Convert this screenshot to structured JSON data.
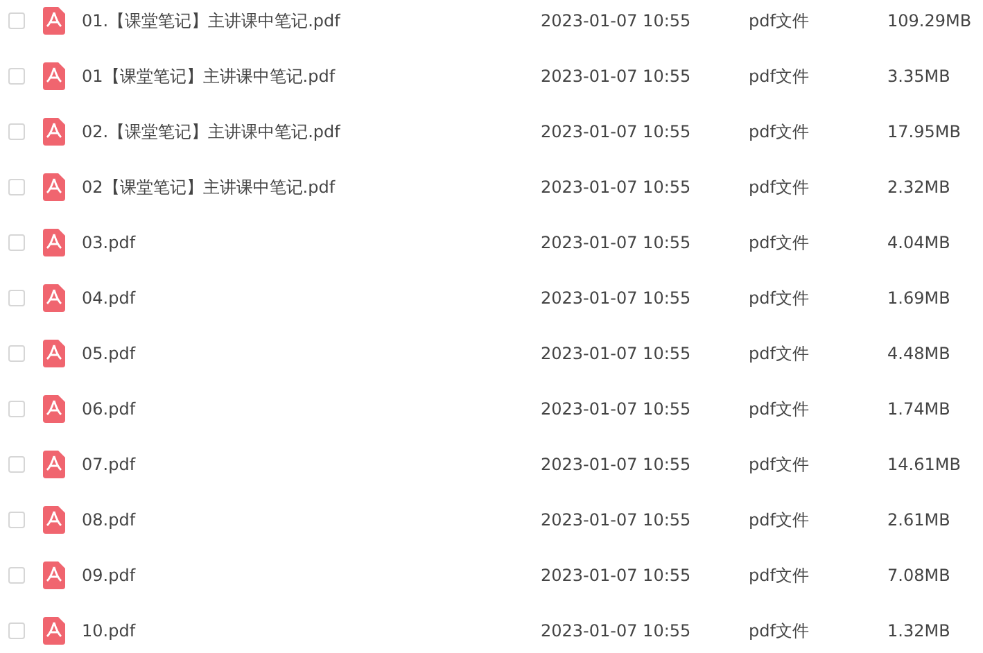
{
  "files": [
    {
      "name": "01.【课堂笔记】主讲课中笔记.pdf",
      "modified": "2023-01-07 10:55",
      "type": "pdf文件",
      "size": "109.29MB",
      "checked": false
    },
    {
      "name": "01【课堂笔记】主讲课中笔记.pdf",
      "modified": "2023-01-07 10:55",
      "type": "pdf文件",
      "size": "3.35MB",
      "checked": false
    },
    {
      "name": "02.【课堂笔记】主讲课中笔记.pdf",
      "modified": "2023-01-07 10:55",
      "type": "pdf文件",
      "size": "17.95MB",
      "checked": false
    },
    {
      "name": "02【课堂笔记】主讲课中笔记.pdf",
      "modified": "2023-01-07 10:55",
      "type": "pdf文件",
      "size": "2.32MB",
      "checked": false
    },
    {
      "name": "03.pdf",
      "modified": "2023-01-07 10:55",
      "type": "pdf文件",
      "size": "4.04MB",
      "checked": false
    },
    {
      "name": "04.pdf",
      "modified": "2023-01-07 10:55",
      "type": "pdf文件",
      "size": "1.69MB",
      "checked": false
    },
    {
      "name": "05.pdf",
      "modified": "2023-01-07 10:55",
      "type": "pdf文件",
      "size": "4.48MB",
      "checked": false
    },
    {
      "name": "06.pdf",
      "modified": "2023-01-07 10:55",
      "type": "pdf文件",
      "size": "1.74MB",
      "checked": false
    },
    {
      "name": "07.pdf",
      "modified": "2023-01-07 10:55",
      "type": "pdf文件",
      "size": "14.61MB",
      "checked": false
    },
    {
      "name": "08.pdf",
      "modified": "2023-01-07 10:55",
      "type": "pdf文件",
      "size": "2.61MB",
      "checked": false
    },
    {
      "name": "09.pdf",
      "modified": "2023-01-07 10:55",
      "type": "pdf文件",
      "size": "7.08MB",
      "checked": false
    },
    {
      "name": "10.pdf",
      "modified": "2023-01-07 10:55",
      "type": "pdf文件",
      "size": "1.32MB",
      "checked": false
    }
  ]
}
